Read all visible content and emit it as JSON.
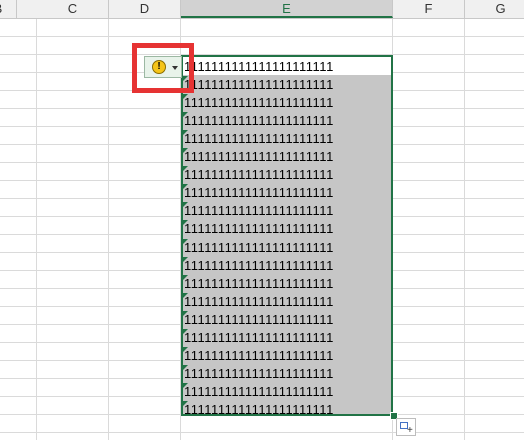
{
  "columns": [
    {
      "label": "B",
      "selected": false
    },
    {
      "label": "C",
      "selected": false
    },
    {
      "label": "D",
      "selected": false
    },
    {
      "label": "E",
      "selected": true
    },
    {
      "label": "F",
      "selected": false
    },
    {
      "label": "G",
      "selected": false
    }
  ],
  "cell_values": [
    "1111111111111111111111",
    "1111111111111111111111",
    "1111111111111111111111",
    "1111111111111111111111",
    "1111111111111111111111",
    "1111111111111111111111",
    "1111111111111111111111",
    "1111111111111111111111",
    "1111111111111111111111",
    "1111111111111111111111",
    "1111111111111111111111",
    "1111111111111111111111",
    "1111111111111111111111",
    "1111111111111111111111",
    "1111111111111111111111",
    "1111111111111111111111",
    "1111111111111111111111",
    "1111111111111111111111",
    "1111111111111111111111",
    "1111111111111111111111"
  ],
  "error_button": {
    "icon": "warning-icon",
    "symbol": "!"
  },
  "colors": {
    "selection_border": "#217346",
    "highlight": "#e63333",
    "selected_fill": "#c6c6c6"
  }
}
